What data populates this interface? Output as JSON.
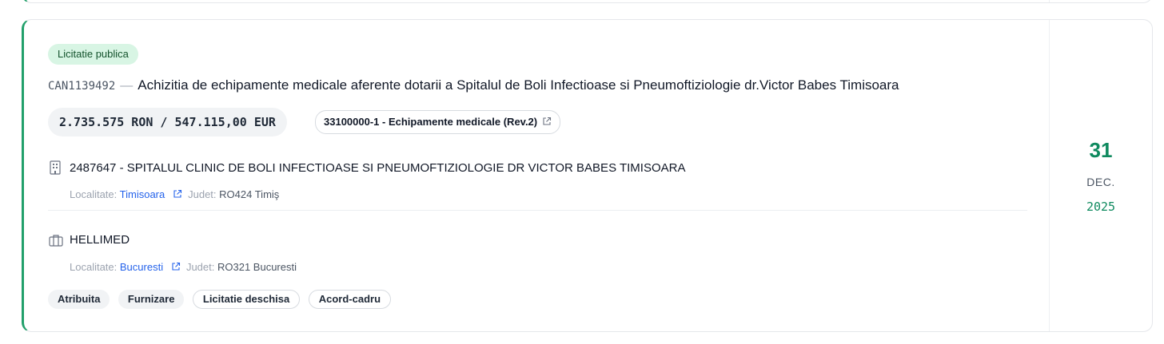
{
  "notice": {
    "procedure_badge": "Licitatie publica",
    "code": "CAN1139492",
    "separator": "—",
    "title": "Achizitia de echipamente medicale aferente dotarii a Spitalul de Boli Infectioase si Pneumoftiziologie dr.Victor Babes Timisoara",
    "amount": "2.735.575 RON / 547.115,00 EUR",
    "cpv": "33100000-1 - Echipamente medicale (Rev.2)",
    "cpv_icon": "external-link-icon"
  },
  "authority": {
    "icon": "building-icon",
    "name": "2487647 - SPITALUL CLINIC DE BOLI INFECTIOASE SI PNEUMOFTIZIOLOGIE DR VICTOR BABES TIMISOARA",
    "locality_label": "Localitate:",
    "locality": "Timisoara",
    "county_label": "Judet:",
    "county": "RO424 Timiş"
  },
  "supplier": {
    "icon": "briefcase-icon",
    "name": "HELLIMED",
    "locality_label": "Localitate:",
    "locality": "Bucuresti",
    "county_label": "Judet:",
    "county": "RO321 Bucuresti"
  },
  "tags": [
    "Atribuita",
    "Furnizare",
    "Licitatie deschisa",
    "Acord-cadru"
  ],
  "date": {
    "day": "31",
    "month": "DEC.",
    "year": "2025"
  },
  "colors": {
    "accent": "#22a06b",
    "date_green": "#0f8a5f",
    "link": "#2563eb",
    "badge_bg": "#d8f5e4"
  }
}
